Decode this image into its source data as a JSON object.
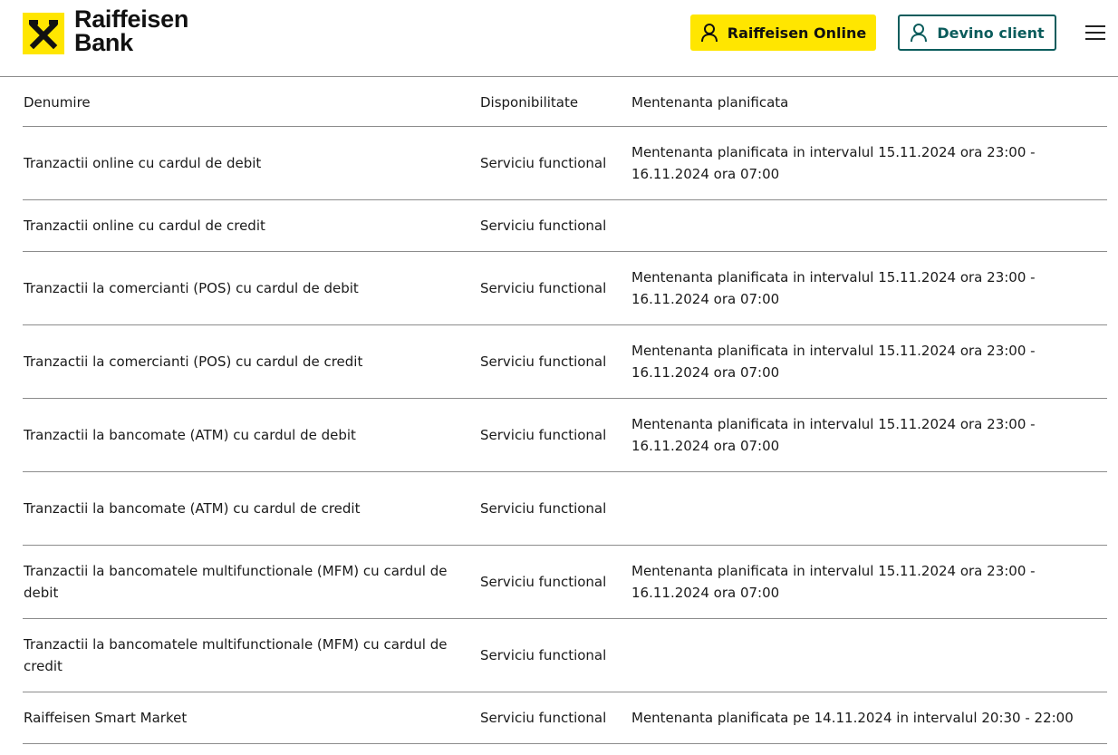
{
  "header": {
    "brand_line1": "Raiffeisen",
    "brand_line2": "Bank",
    "online_button": "Raiffeisen Online",
    "client_button": "Devino client",
    "accent_color": "#ffe600",
    "secondary_color": "#0b5c5c"
  },
  "table": {
    "columns": [
      "Denumire",
      "Disponibilitate",
      "Mentenanta planificata"
    ],
    "rows": [
      {
        "name": "Tranzactii online cu cardul de debit",
        "status": "Serviciu functional",
        "maintenance": "Mentenanta planificata in intervalul 15.11.2024 ora 23:00 - 16.11.2024 ora 07:00"
      },
      {
        "name": "Tranzactii online cu cardul de credit",
        "status": "Serviciu functional",
        "maintenance": ""
      },
      {
        "name": "Tranzactii la comercianti (POS) cu cardul de debit",
        "status": "Serviciu functional",
        "maintenance": "Mentenanta planificata in intervalul 15.11.2024 ora 23:00 - 16.11.2024 ora 07:00"
      },
      {
        "name": "Tranzactii la comercianti (POS) cu cardul de credit",
        "status": "Serviciu functional",
        "maintenance": "Mentenanta planificata in intervalul 15.11.2024 ora 23:00 - 16.11.2024 ora 07:00"
      },
      {
        "name": "Tranzactii la bancomate (ATM) cu cardul de debit",
        "status": "Serviciu functional",
        "maintenance": "Mentenanta planificata in intervalul 15.11.2024 ora 23:00 - 16.11.2024 ora 07:00"
      },
      {
        "name": "Tranzactii la bancomate (ATM) cu cardul de credit",
        "status": "Serviciu functional",
        "maintenance": ""
      },
      {
        "name": "Tranzactii la bancomatele multifunctionale (MFM) cu cardul de debit",
        "status": "Serviciu functional",
        "maintenance": "Mentenanta planificata in intervalul 15.11.2024 ora 23:00 - 16.11.2024 ora 07:00"
      },
      {
        "name": "Tranzactii la bancomatele multifunctionale (MFM) cu cardul de credit",
        "status": "Serviciu functional",
        "maintenance": ""
      },
      {
        "name": "Raiffeisen Smart Market",
        "status": "Serviciu functional",
        "maintenance": "Mentenanta planificata pe 14.11.2024 in intervalul 20:30 - 22:00"
      }
    ]
  }
}
